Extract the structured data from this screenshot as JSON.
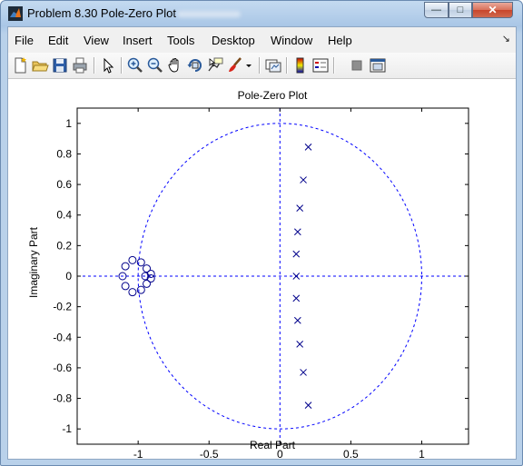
{
  "window": {
    "title": "Problem 8.30 Pole-Zero Plot",
    "controls": {
      "minimize": "—",
      "maximize": "□",
      "close": "✕"
    }
  },
  "menu": {
    "items": [
      "File",
      "Edit",
      "View",
      "Insert",
      "Tools",
      "Desktop",
      "Window",
      "Help"
    ],
    "dock_arrow": "↘"
  },
  "toolbar": {
    "icons": [
      "new-figure-icon",
      "open-file-icon",
      "save-icon",
      "print-icon",
      "edit-plot-arrow-icon",
      "zoom-in-icon",
      "zoom-out-icon",
      "pan-hand-icon",
      "rotate-3d-icon",
      "data-cursor-icon",
      "brush-icon",
      "brush-dropdown-icon",
      "link-plot-icon",
      "colorbar-icon",
      "legend-icon",
      "hide-plot-tools-icon",
      "show-plot-tools-icon"
    ]
  },
  "colors": {
    "plot": "#00008b",
    "unit_circle": "#0000ff",
    "axis_frame": "#000000"
  },
  "chart_data": {
    "type": "scatter",
    "title": "Pole-Zero Plot",
    "xlabel": "Real Part",
    "ylabel": "Imaginary Part",
    "xlim": [
      -1.43,
      1.33
    ],
    "ylim": [
      -1.1,
      1.1
    ],
    "xticks": [
      -1,
      -0.5,
      0,
      0.5,
      1
    ],
    "xtick_labels": [
      "-1",
      "-0.5",
      "0",
      "0.5",
      "1"
    ],
    "yticks": [
      -1,
      -0.8,
      -0.6,
      -0.4,
      -0.2,
      0,
      0.2,
      0.4,
      0.6,
      0.8,
      1
    ],
    "ytick_labels": [
      "-1",
      "-0.8",
      "-0.6",
      "-0.4",
      "-0.2",
      "0",
      "0.2",
      "0.4",
      "0.6",
      "0.8",
      "1"
    ],
    "grid": false,
    "unit_circle": true,
    "series": [
      {
        "marker": "o",
        "points": [
          [
            -1.11,
            0.0
          ],
          [
            -1.09,
            0.065
          ],
          [
            -1.09,
            -0.065
          ],
          [
            -1.04,
            0.105
          ],
          [
            -1.04,
            -0.105
          ],
          [
            -0.98,
            0.09
          ],
          [
            -0.98,
            -0.09
          ],
          [
            -0.94,
            0.05
          ],
          [
            -0.94,
            -0.05
          ],
          [
            -0.91,
            0.015
          ],
          [
            -0.91,
            -0.015
          ],
          [
            -0.95,
            0.0
          ]
        ]
      },
      {
        "marker": "x",
        "points": [
          [
            0.2,
            0.845
          ],
          [
            0.165,
            0.63
          ],
          [
            0.14,
            0.445
          ],
          [
            0.125,
            0.29
          ],
          [
            0.115,
            0.145
          ],
          [
            0.115,
            0.0
          ],
          [
            0.115,
            -0.145
          ],
          [
            0.125,
            -0.29
          ],
          [
            0.14,
            -0.445
          ],
          [
            0.165,
            -0.63
          ],
          [
            0.2,
            -0.845
          ]
        ]
      }
    ]
  }
}
